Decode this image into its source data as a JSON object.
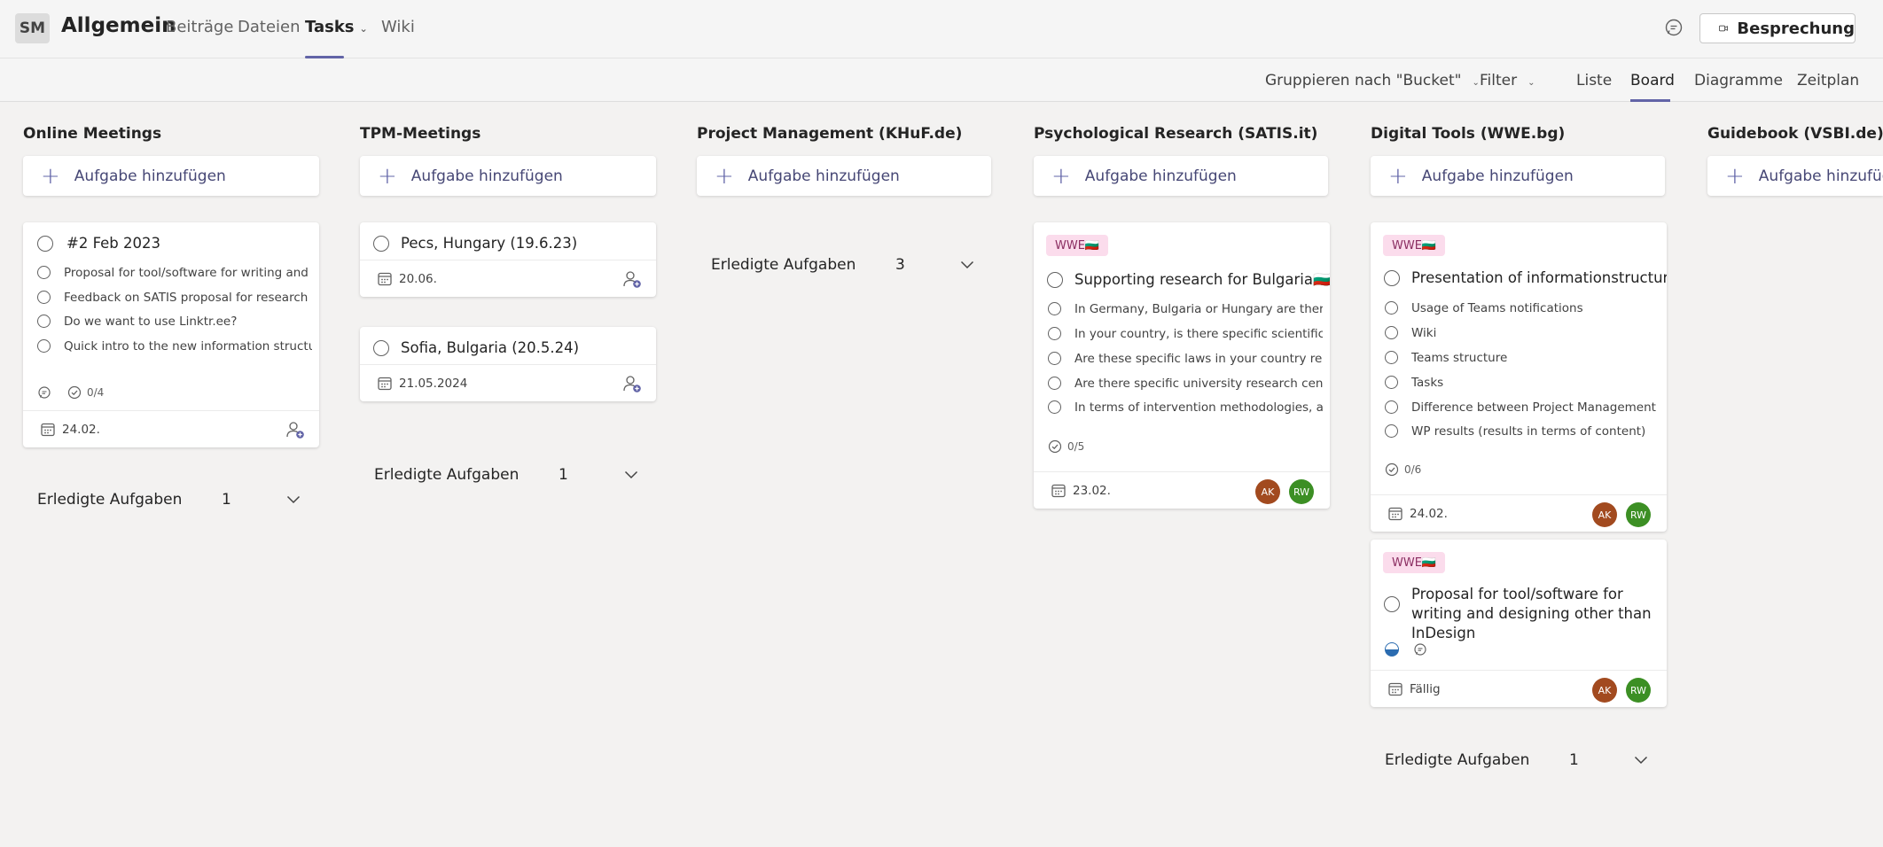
{
  "header": {
    "avatar_initials": "SM",
    "channel_title": "Allgemein",
    "tabs": [
      {
        "label": "Beiträge"
      },
      {
        "label": "Dateien"
      },
      {
        "label": "Tasks"
      },
      {
        "label": "Wiki"
      }
    ],
    "meeting_button": "Besprechung"
  },
  "toolbar": {
    "group_by": "Gruppieren nach \"Bucket\"",
    "filter": "Filter",
    "views": [
      {
        "label": "Liste"
      },
      {
        "label": "Board"
      },
      {
        "label": "Diagramme"
      },
      {
        "label": "Zeitplan"
      }
    ],
    "active_view": "Board"
  },
  "add_task_label": "Aufgabe hinzufügen",
  "done_label": "Erledigte Aufgaben",
  "buckets": [
    {
      "title": "Online Meetings",
      "done_count": "1",
      "cards": [
        {
          "title": "#2 Feb 2023",
          "checklist": [
            "Proposal for tool/software for writing and designing other than InDesign",
            "Feedback on SATIS proposal for research methodology",
            "Do we want to use Linktr.ee?",
            "Quick intro to the new information structure."
          ],
          "checklist_progress": "0/4",
          "date": "24.02."
        }
      ]
    },
    {
      "title": "TPM-Meetings",
      "done_count": "1",
      "cards": [
        {
          "title": "Pecs, Hungary (19.6.23)",
          "date": "20.06."
        },
        {
          "title": "Sofia, Bulgaria (20.5.24)",
          "date": "21.05.2024"
        }
      ]
    },
    {
      "title": "Project Management (KHuF.de)",
      "done_count": "3",
      "cards": []
    },
    {
      "title": "Psychological Research (SATIS.it)",
      "cards": [
        {
          "label": "WWE🇧🇬",
          "title": "Supporting research for Bulgaria🇧🇬",
          "checklist": [
            "In Germany, Bulgaria or Hungary are there research institutions",
            "In your country, is there specific scientific research",
            "Are these specific laws in your country related to research",
            "Are there specific university research centers",
            "In terms of intervention methodologies, are there"
          ],
          "checklist_progress": "0/5",
          "date": "23.02.",
          "assignees": [
            "AK",
            "RW"
          ]
        }
      ]
    },
    {
      "title": "Digital Tools (WWE.bg)",
      "done_count": "1",
      "cards": [
        {
          "label": "WWE🇧🇬",
          "title": "Presentation of informationstructure",
          "checklist": [
            "Usage of Teams notifications",
            "Wiki",
            "Teams structure",
            "Tasks",
            "Difference between Project Management (online)",
            "WP results (results in terms of content)"
          ],
          "checklist_progress": "0/6",
          "date": "24.02.",
          "assignees": [
            "AK",
            "RW"
          ]
        },
        {
          "label": "WWE🇧🇬",
          "title": "Proposal for tool/software for writing and designing other than InDesign",
          "date": "Fällig",
          "assignees": [
            "AK",
            "RW"
          ]
        }
      ]
    },
    {
      "title": "Guidebook (VSBI.de)",
      "cards": []
    }
  ],
  "colors": {
    "accent": "#6264a7",
    "label_bg": "#fbdcec",
    "avatar_ak": "#a24a1f",
    "avatar_rw": "#3c8f24"
  }
}
